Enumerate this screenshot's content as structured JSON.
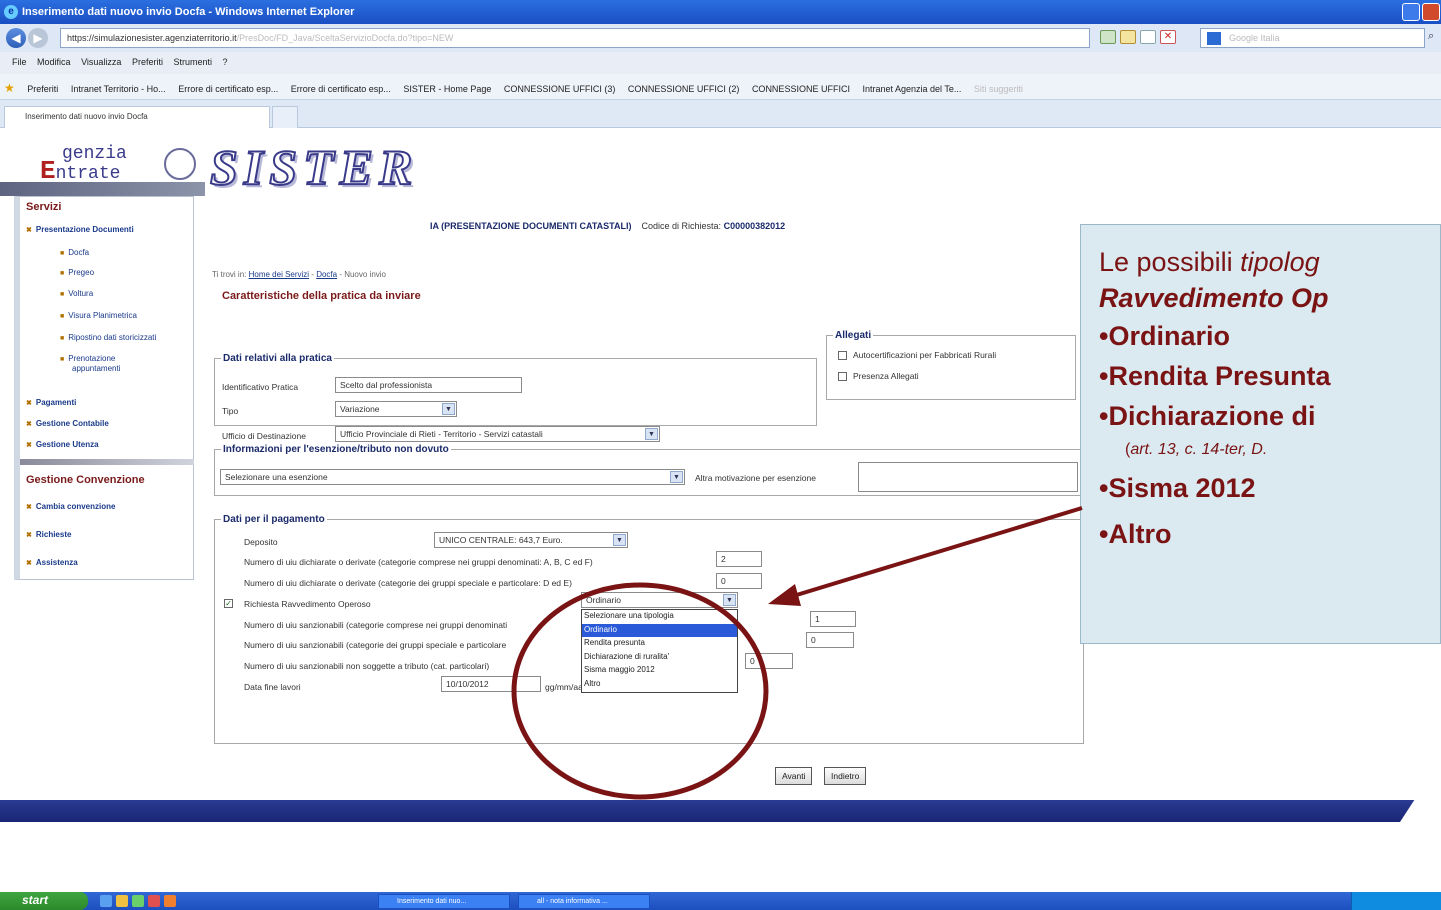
{
  "window": {
    "title": "Inserimento dati nuovo invio Docfa - Windows Internet Explorer"
  },
  "address": {
    "url": "https://simulazionesister.agenziaterritorio.it",
    "url_path": "/PresDoc/FD_Java/SceltaServizioDocfa.do?tipo=NEW",
    "search_placeholder": "Google Italia"
  },
  "menu": [
    "File",
    "Modifica",
    "Visualizza",
    "Preferiti",
    "Strumenti",
    "?"
  ],
  "favorites": {
    "label": "Preferiti",
    "items": [
      "Intranet Territorio - Ho...",
      "Errore di certificato esp...",
      "Errore di certificato esp...",
      "SISTER - Home Page",
      "CONNESSIONE UFFICI (3)",
      "CONNESSIONE UFFICI (2)",
      "CONNESSIONE UFFICI",
      "Intranet Agenzia del Te...",
      "Siti suggeriti"
    ]
  },
  "tab": {
    "label": "Inserimento dati nuovo invio Docfa"
  },
  "logo": {
    "agency_line1": "genzia",
    "agency_line2": "ntrate",
    "agency_e": "E",
    "site": "SISTER"
  },
  "sidebar": {
    "servizi_title": "Servizi",
    "items": [
      {
        "label": "Presentazione Documenti",
        "main": true
      },
      {
        "label": "Docfa",
        "main": false
      },
      {
        "label": "Pregeo",
        "main": false
      },
      {
        "label": "Voltura",
        "main": false
      },
      {
        "label": "Visura Planimetrica",
        "main": false
      },
      {
        "label": "Ripostino dati storicizzati",
        "main": false
      },
      {
        "label": "Prenotazione",
        "main": false
      },
      {
        "label": "appuntamenti",
        "main": false
      },
      {
        "label": "Pagamenti",
        "main": true
      },
      {
        "label": "Gestione Contabile",
        "main": true
      },
      {
        "label": "Gestione Utenza",
        "main": true
      }
    ],
    "convenzione_title": "Gestione Convenzione",
    "conv_items": [
      "Cambia convenzione",
      "Richieste",
      "Assistenza"
    ]
  },
  "header": {
    "title": "IA (PRESENTAZIONE DOCUMENTI CATASTALI)",
    "code_label": "Codice di Richiesta:",
    "code_value": "C00000382012"
  },
  "breadcrumb": {
    "prefix": "Ti trovi in:",
    "home": "Home dei Servizi",
    "docfa": "Docfa",
    "current": "Nuovo invio"
  },
  "page_heading": "Caratteristiche della pratica da inviare",
  "pratica": {
    "legend": "Dati relativi alla pratica",
    "id_label": "Identificativo Pratica",
    "id_value": "Scelto dal professionista",
    "tipo_label": "Tipo",
    "tipo_value": "Variazione",
    "ufficio_label": "Ufficio di Destinazione",
    "ufficio_value": "Ufficio Provinciale di Rieti - Territorio - Servizi catastali"
  },
  "allegati": {
    "legend": "Allegati",
    "item1": "Autocertificazioni per Fabbricati Rurali",
    "item2": "Presenza Allegati"
  },
  "esenzione": {
    "legend": "Informazioni per l'esenzione/tributo non dovuto",
    "select_value": "Selezionare una esenzione",
    "altra_label": "Altra motivazione per esenzione"
  },
  "pagamento": {
    "legend": "Dati per il pagamento",
    "deposito_label": "Deposito",
    "deposito_value": "UNICO CENTRALE: 643,7 Euro.",
    "ui_ordinarie_label": "Numero di uiu dichiarate o derivate (categorie comprese nei gruppi denominati: A, B, C ed F)",
    "ui_ordinarie_value": "2",
    "ui_speciali_label": "Numero di uiu dichiarate o derivate (categorie dei gruppi speciale e particolare: D ed E)",
    "ui_speciali_value": "0",
    "ravv_label": "Richiesta Ravvedimento Operoso",
    "ravv_value": "Ordinario",
    "sanz1_label": "Numero di uiu sanzionabili (categorie comprese nei gruppi denominati",
    "sanz1_value": "1",
    "sanz2_label": "Numero di uiu sanzionabili (categorie dei gruppi speciale e particolare",
    "sanz2_value": "0",
    "sanz3_label": "Numero di uiu sanzionabili non soggette a tributo (cat. particolari)",
    "sanz3_value": "0",
    "data_label": "Data fine lavori",
    "data_value": "10/10/2012",
    "data_format": "gg/mm/aaaa"
  },
  "dropdown": {
    "options": [
      "Selezionare una tipologia",
      "Ordinario",
      "Rendita presunta",
      "Dichiarazione di ruralita'",
      "Sisma maggio 2012",
      "Altro"
    ],
    "selected_index": 1
  },
  "buttons": {
    "avanti": "Avanti",
    "indietro": "Indietro"
  },
  "callout": {
    "line1_plain": "Le possibili ",
    "line1_italic": "tipolog",
    "line2": "Ravvedimento Op",
    "opt1": "•Ordinario",
    "opt2": "•Rendita Presunta",
    "opt3": "•Dichiarazione di",
    "note_open": "(",
    "note": "art. 13, c. 14-ter, D.",
    "opt4": "•Sisma 2012",
    "opt5": "•Altro"
  },
  "taskbar": {
    "start": "start",
    "items": [
      "Inserimento dati nuo...",
      "all - nota informativa ..."
    ]
  },
  "colors": {
    "accent": "#7a1414",
    "callout_bg": "#dbe9f0",
    "footer": "#1a2674"
  }
}
